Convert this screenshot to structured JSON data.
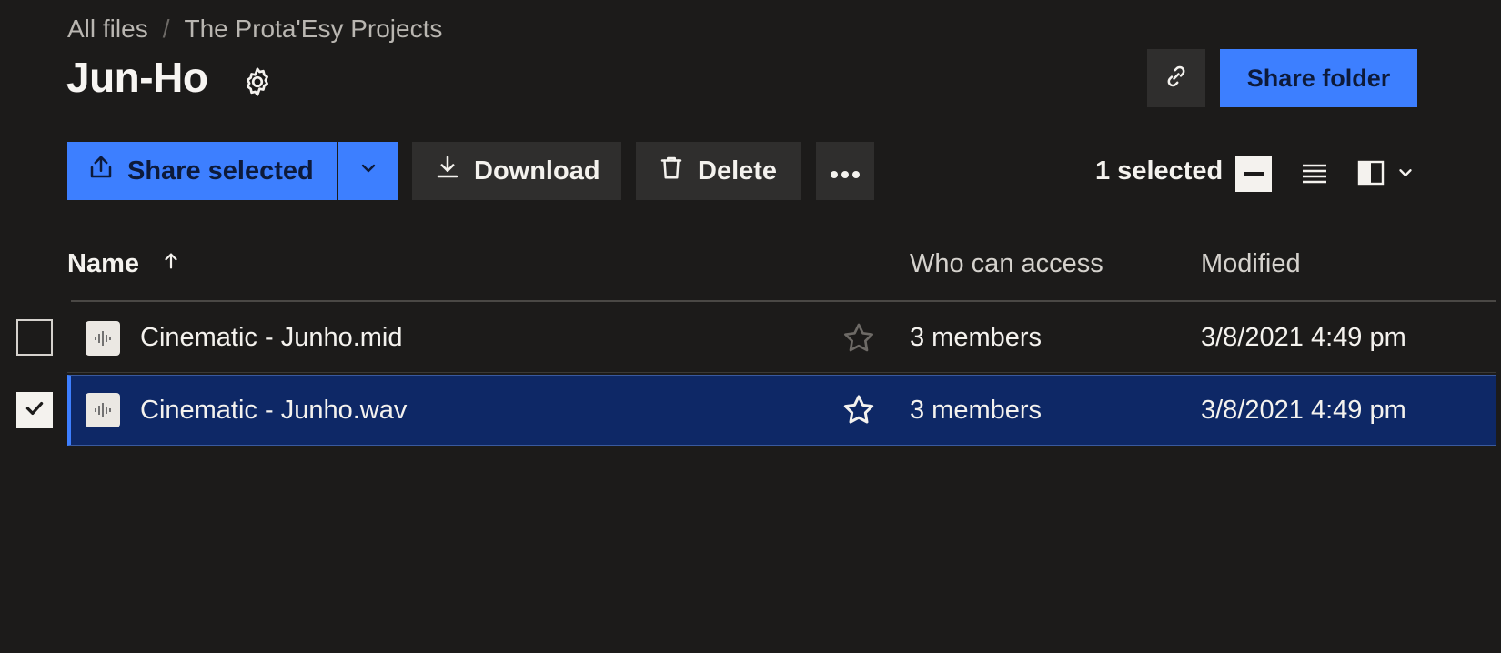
{
  "breadcrumb": {
    "items": [
      "All files",
      "The Prota'Esy Projects"
    ],
    "separator": "/"
  },
  "folder": {
    "title": "Jun-Ho",
    "settings_icon": "gear-icon"
  },
  "header_actions": {
    "copy_link_icon": "link-icon",
    "share_folder_label": "Share folder"
  },
  "toolbar": {
    "share_selected_label": "Share selected",
    "share_dropdown_icon": "chevron-down-icon",
    "download_label": "Download",
    "delete_label": "Delete",
    "more_icon": "more-horizontal-icon",
    "selection_count": "1 selected",
    "view_mode_icon": "list-view-icon",
    "panel_icon": "side-panel-icon"
  },
  "table": {
    "columns": [
      "Name",
      "Who can access",
      "Modified"
    ],
    "sort": {
      "column": "Name",
      "direction": "ascending"
    },
    "rows": [
      {
        "name": "Cinematic - Junho.mid",
        "access": "3 members",
        "modified": "3/8/2021 4:49 pm",
        "selected": false
      },
      {
        "name": "Cinematic - Junho.wav",
        "access": "3 members",
        "modified": "3/8/2021 4:49 pm",
        "selected": true
      }
    ]
  },
  "colors": {
    "background": "#1c1b1a",
    "accent": "#3d7fff",
    "selected_row": "#0e2866",
    "button_secondary": "#2f2e2d"
  }
}
